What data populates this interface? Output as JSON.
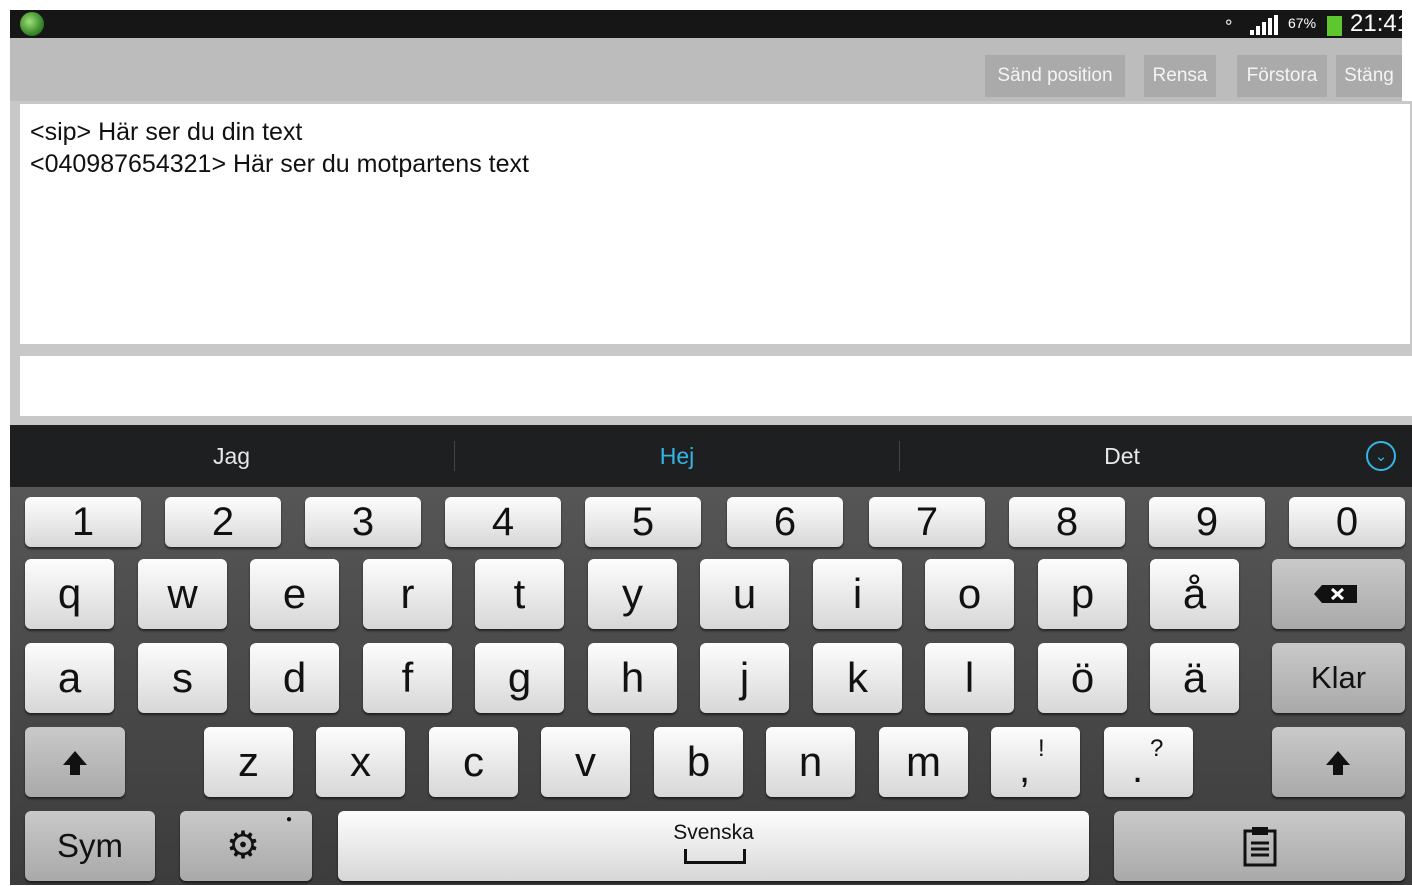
{
  "status_bar": {
    "battery_percent": "67%",
    "time": "21:41",
    "battery_color": "#5ec62f"
  },
  "toolbar": {
    "send_position": "Sänd position",
    "clear": "Rensa",
    "enlarge": "Förstora",
    "close": "Stäng"
  },
  "chat_log": {
    "lines": [
      "<sip> Här ser du din text",
      "<040987654321> Här ser du motpartens text"
    ]
  },
  "message_input": {
    "value": ""
  },
  "suggestions": {
    "items": [
      "Jag",
      "Hej",
      "Det"
    ],
    "highlight_color": "#33b5e5"
  },
  "keyboard": {
    "numbers": [
      "1",
      "2",
      "3",
      "4",
      "5",
      "6",
      "7",
      "8",
      "9",
      "0"
    ],
    "row1": [
      "q",
      "w",
      "e",
      "r",
      "t",
      "y",
      "u",
      "i",
      "o",
      "p",
      "å"
    ],
    "row2": [
      "a",
      "s",
      "d",
      "f",
      "g",
      "h",
      "j",
      "k",
      "l",
      "ö",
      "ä"
    ],
    "row3": [
      "z",
      "x",
      "c",
      "v",
      "b",
      "n",
      "m"
    ],
    "comma_main": ",",
    "comma_alt": "!",
    "period_main": ".",
    "period_alt": "?",
    "enter_label": "Klar",
    "sym_label": "Sym",
    "space_label": "Svenska"
  }
}
